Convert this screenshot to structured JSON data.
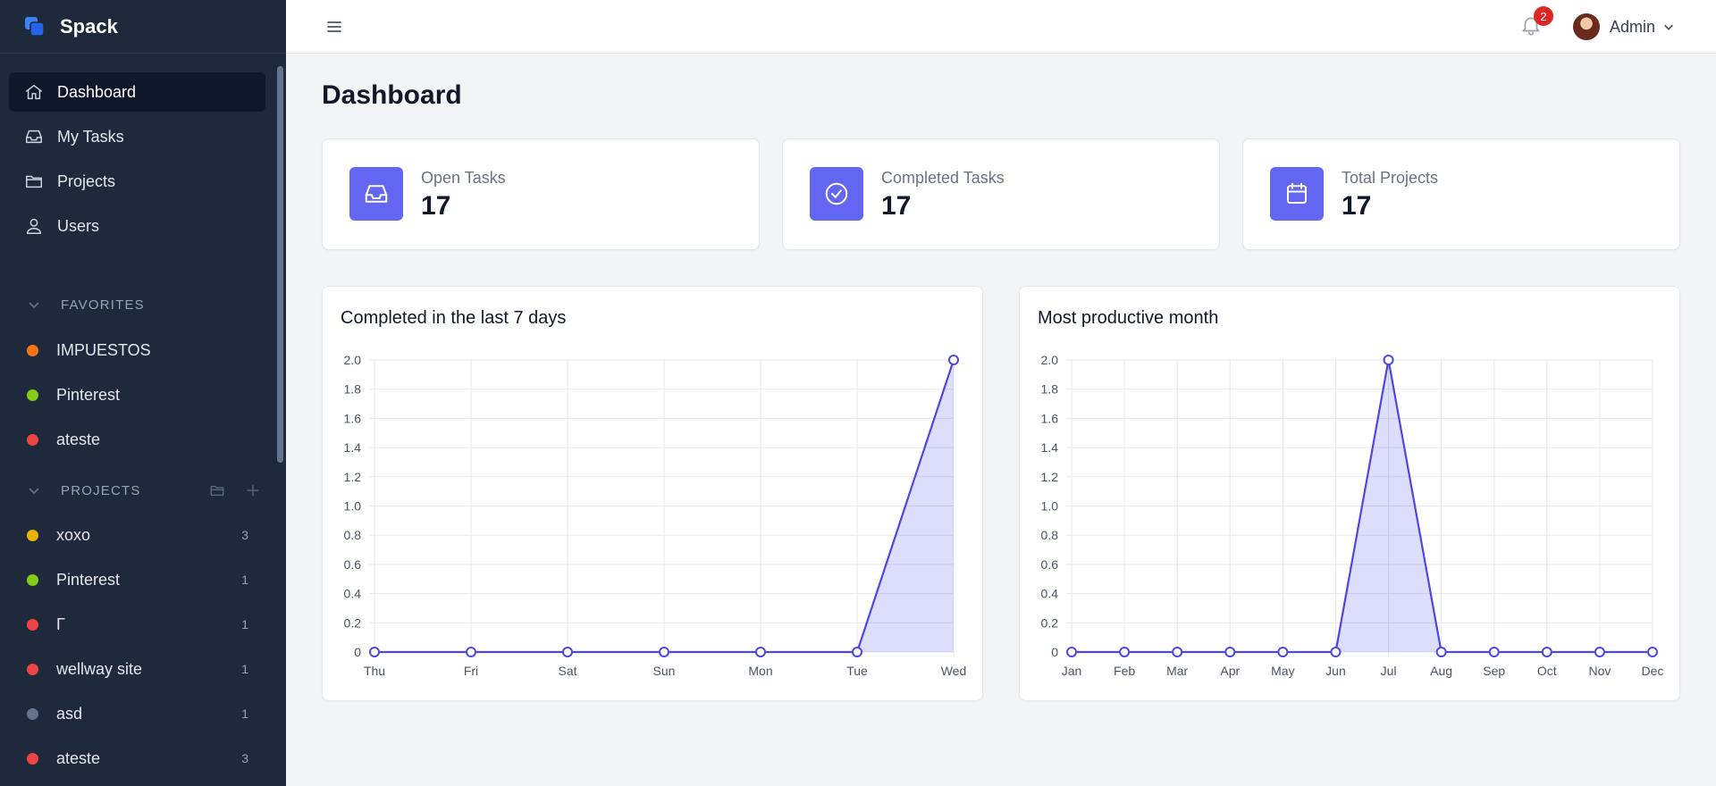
{
  "app": {
    "name": "Spack"
  },
  "sidebar": {
    "nav": [
      {
        "label": "Dashboard",
        "icon": "home-icon",
        "active": true
      },
      {
        "label": "My Tasks",
        "icon": "inbox-icon",
        "active": false
      },
      {
        "label": "Projects",
        "icon": "folder-icon",
        "active": false
      },
      {
        "label": "Users",
        "icon": "user-icon",
        "active": false
      }
    ],
    "favorites": {
      "heading": "FAVORITES",
      "items": [
        {
          "label": "IMPUESTOS",
          "color": "#f97316"
        },
        {
          "label": "Pinterest",
          "color": "#84cc16"
        },
        {
          "label": "ateste",
          "color": "#ef4444"
        }
      ]
    },
    "projects": {
      "heading": "PROJECTS",
      "items": [
        {
          "label": "xoxo",
          "color": "#eab308",
          "count": "3"
        },
        {
          "label": "Pinterest",
          "color": "#84cc16",
          "count": "1"
        },
        {
          "label": "Γ",
          "color": "#ef4444",
          "count": "1"
        },
        {
          "label": "wellway site",
          "color": "#ef4444",
          "count": "1"
        },
        {
          "label": "asd",
          "color": "#64748b",
          "count": "1"
        },
        {
          "label": "ateste",
          "color": "#ef4444",
          "count": "3"
        }
      ]
    }
  },
  "header": {
    "notifications_count": "2",
    "user_name": "Admin"
  },
  "main": {
    "title": "Dashboard",
    "stats": [
      {
        "label": "Open Tasks",
        "value": "17",
        "icon": "inbox-icon"
      },
      {
        "label": "Completed Tasks",
        "value": "17",
        "icon": "check-circle-icon"
      },
      {
        "label": "Total Projects",
        "value": "17",
        "icon": "calendar-icon"
      }
    ],
    "accent_color": "#6366f1"
  },
  "chart_data": [
    {
      "type": "area",
      "title": "Completed in the last 7 days",
      "categories": [
        "Thu",
        "Fri",
        "Sat",
        "Sun",
        "Mon",
        "Tue",
        "Wed"
      ],
      "values": [
        0,
        0,
        0,
        0,
        0,
        0,
        2
      ],
      "ylim": [
        0,
        2.0
      ],
      "yticks": [
        "0",
        "0.2",
        "0.4",
        "0.6",
        "0.8",
        "1.0",
        "1.2",
        "1.4",
        "1.6",
        "1.8",
        "2.0"
      ],
      "grid": true,
      "color": "#4f46e5"
    },
    {
      "type": "area",
      "title": "Most productive month",
      "categories": [
        "Jan",
        "Feb",
        "Mar",
        "Apr",
        "May",
        "Jun",
        "Jul",
        "Aug",
        "Sep",
        "Oct",
        "Nov",
        "Dec"
      ],
      "values": [
        0,
        0,
        0,
        0,
        0,
        0,
        2,
        0,
        0,
        0,
        0,
        0
      ],
      "ylim": [
        0,
        2.0
      ],
      "yticks": [
        "0",
        "0.2",
        "0.4",
        "0.6",
        "0.8",
        "1.0",
        "1.2",
        "1.4",
        "1.6",
        "1.8",
        "2.0"
      ],
      "grid": true,
      "color": "#4f46e5"
    }
  ]
}
